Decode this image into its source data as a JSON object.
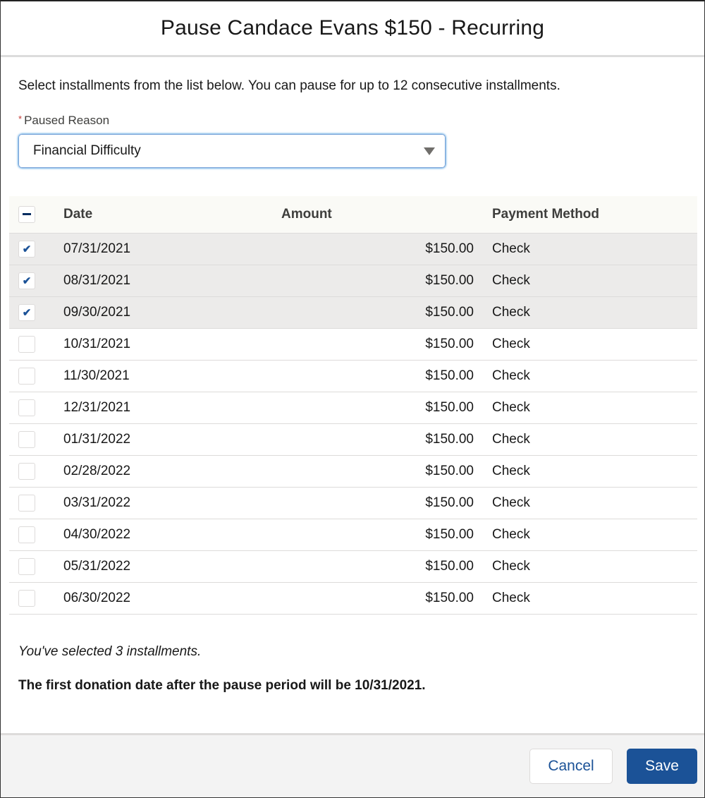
{
  "dialog": {
    "title": "Pause Candace Evans $150 - Recurring",
    "intro": "Select installments from the list below. You can pause for up to 12 consecutive installments."
  },
  "paused_reason": {
    "required_marker": "*",
    "label": "Paused Reason",
    "value": "Financial Difficulty"
  },
  "table": {
    "columns": [
      "Date",
      "Amount",
      "Payment Method"
    ],
    "select_all_state": "indeterminate",
    "rows": [
      {
        "date": "07/31/2021",
        "amount": "$150.00",
        "method": "Check",
        "checked": true
      },
      {
        "date": "08/31/2021",
        "amount": "$150.00",
        "method": "Check",
        "checked": true
      },
      {
        "date": "09/30/2021",
        "amount": "$150.00",
        "method": "Check",
        "checked": true
      },
      {
        "date": "10/31/2021",
        "amount": "$150.00",
        "method": "Check",
        "checked": false
      },
      {
        "date": "11/30/2021",
        "amount": "$150.00",
        "method": "Check",
        "checked": false
      },
      {
        "date": "12/31/2021",
        "amount": "$150.00",
        "method": "Check",
        "checked": false
      },
      {
        "date": "01/31/2022",
        "amount": "$150.00",
        "method": "Check",
        "checked": false
      },
      {
        "date": "02/28/2022",
        "amount": "$150.00",
        "method": "Check",
        "checked": false
      },
      {
        "date": "03/31/2022",
        "amount": "$150.00",
        "method": "Check",
        "checked": false
      },
      {
        "date": "04/30/2022",
        "amount": "$150.00",
        "method": "Check",
        "checked": false
      },
      {
        "date": "05/31/2022",
        "amount": "$150.00",
        "method": "Check",
        "checked": false
      },
      {
        "date": "06/30/2022",
        "amount": "$150.00",
        "method": "Check",
        "checked": false
      }
    ]
  },
  "summary": {
    "selected_text": "You've selected 3 installments.",
    "first_date_text": "The first donation date after the pause period will be 10/31/2021."
  },
  "footer": {
    "cancel_label": "Cancel",
    "save_label": "Save"
  },
  "colors": {
    "brand": "#1b5297",
    "selected_row": "#ecebea",
    "required": "#c23934"
  }
}
